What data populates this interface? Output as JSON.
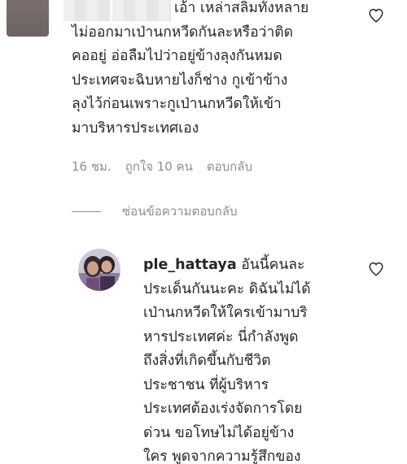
{
  "comment1": {
    "lines": [
      "เอ้า เหล่าสลิ่มทั้งหลาย",
      "ไม่ออกมาเป่านกหวีดกันละหรือว่าติด",
      "คออยู่ อ่อลืมไปว่าอยู่ข้างลุงกันหมด",
      "ประเทศจะฉิบหายไงก็ช่าง กูเข้าข้าง",
      "ลุงไว้ก่อนเพราะกูเป่านกหวีดให้เข้า",
      "มาบริหารประเทศเอง"
    ],
    "time": "16 ชม.",
    "likes": "ถูกใจ 10 คน",
    "reply_label": "ตอบกลับ"
  },
  "hide_replies_label": "ซ่อนข้อความตอบกลับ",
  "reply1": {
    "username": "ple_hattaya",
    "first_line_rest": " อันนี้คนละ",
    "lines": [
      "ประเด็นกันนะคะ ดิฉันไม่ได้",
      "เป่านกหวีดให้ใครเข้ามาบริ",
      "หารประเทศค่ะ นี่กำลังพูด",
      "ถึงสิ่งที่เกิดขึ้นกับชีวิต",
      "ประชาชน ที่ผู้บริหาร",
      "ประเทศต้องเร่งจัดการโดย",
      "ด่วน ขอโทษไม่ได้อยู่ข้าง",
      "ใคร พูดจากความรู้สึกของ"
    ]
  },
  "icons": {
    "heart": "heart-outline-icon"
  },
  "colors": {
    "text": "#262626",
    "secondary": "#8e8e8e",
    "background": "#ffffff"
  }
}
